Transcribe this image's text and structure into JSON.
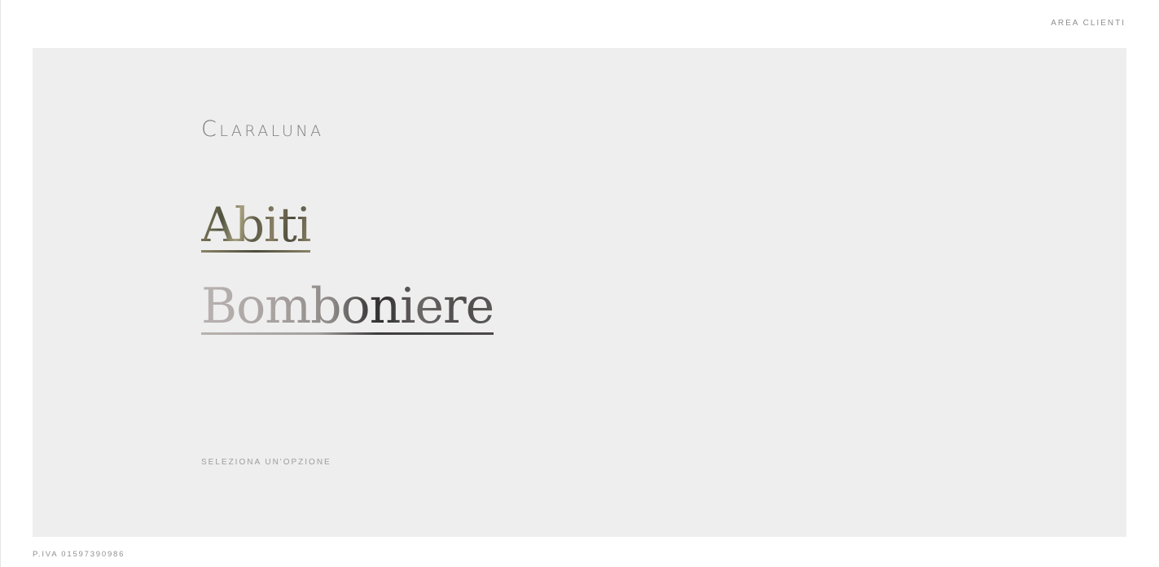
{
  "header": {
    "client_area_label": "AREA CLIENTI"
  },
  "main": {
    "brand_name": "Claraluna",
    "menu": [
      {
        "label": "Abiti"
      },
      {
        "label": "Bomboniere"
      }
    ],
    "hint": "SELEZIONA UN'OPZIONE"
  },
  "footer": {
    "vat": "P.IVA 01597390986"
  }
}
